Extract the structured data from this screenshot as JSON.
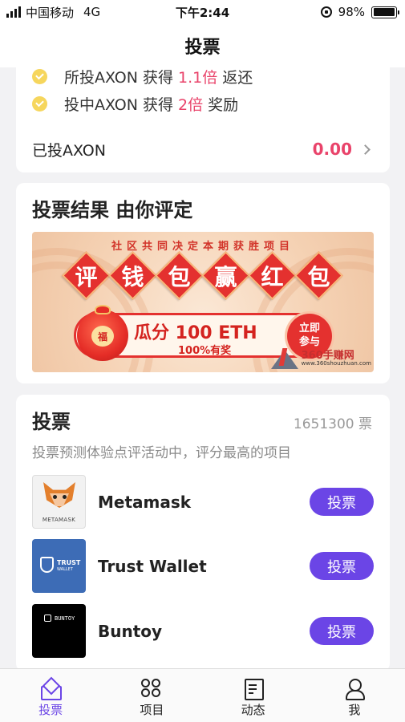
{
  "status_bar": {
    "carrier": "中国移动",
    "network": "4G",
    "time": "下午2:44",
    "battery_percent": "98%",
    "battery_level": 0.98
  },
  "nav": {
    "title": "投票"
  },
  "reward_card": {
    "rows": [
      {
        "prefix": "所投AXON 获得",
        "highlight": "1.1倍",
        "suffix": "返还"
      },
      {
        "prefix": "投中AXON 获得",
        "highlight": "2倍",
        "suffix": "奖励"
      }
    ],
    "voted_label": "已投AXON",
    "voted_value": "0.00"
  },
  "result_card": {
    "title": "投票结果 由你评定",
    "banner": {
      "subtitle": "社区共同决定本期获胜项目",
      "chars": [
        "评",
        "钱",
        "包",
        "赢",
        "红",
        "包"
      ],
      "main_text": "瓜分 100 ETH",
      "sub_text": "100%有奖",
      "bag_label": "福",
      "join_label_line1": "立即",
      "join_label_line2": "参与"
    },
    "watermark": {
      "brand": "360手赚网",
      "url": "www.360shouzhuan.com"
    }
  },
  "vote_card": {
    "title": "投票",
    "count": "1651300 票",
    "description": "投票预测体验点评活动中，评分最高的项目",
    "projects": [
      {
        "name": "Metamask",
        "logo_caption": "METAMASK",
        "button": "投票"
      },
      {
        "name": "Trust Wallet",
        "logo_caption": "TRUST",
        "logo_caption_small": "WALLET",
        "button": "投票"
      },
      {
        "name": "Buntoy",
        "logo_caption": "BUNTOY",
        "button": "投票"
      }
    ]
  },
  "tab_bar": {
    "tabs": [
      {
        "label": "投票",
        "icon": "ballot-box-icon",
        "active": true
      },
      {
        "label": "项目",
        "icon": "grid-icon",
        "active": false
      },
      {
        "label": "动态",
        "icon": "document-icon",
        "active": false
      },
      {
        "label": "我",
        "icon": "user-icon",
        "active": false
      }
    ]
  },
  "colors": {
    "accent": "#6b45e6",
    "highlight": "#e9436a",
    "banner_red": "#e4312f"
  }
}
